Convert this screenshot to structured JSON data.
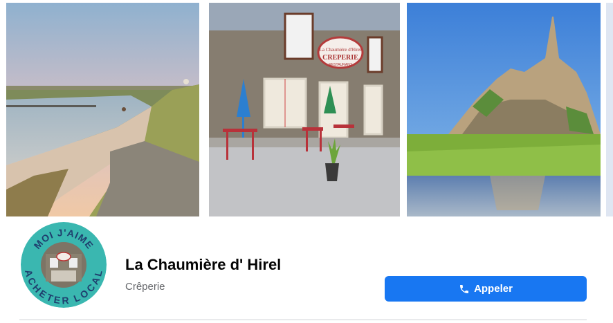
{
  "page": {
    "name": "La Chaumière d' Hirel",
    "category": "Crêperie"
  },
  "actions": {
    "call_label": "Appeler"
  },
  "cover": {
    "restaurant_sign_line1": "La Chaumière d'Hirel",
    "restaurant_sign_line2": "CREPERIE",
    "restaurant_sign_line3": "RESTAURANT"
  },
  "avatar": {
    "ring_text_top": "MOI J'AIME",
    "ring_text_bottom": "ACHETER LOCAL",
    "ring_color": "#3ab7b0"
  },
  "colors": {
    "primary_button": "#1877f2",
    "title_text": "#050505",
    "secondary_text": "#65676b"
  },
  "icons": {
    "call_icon": "phone-icon"
  }
}
